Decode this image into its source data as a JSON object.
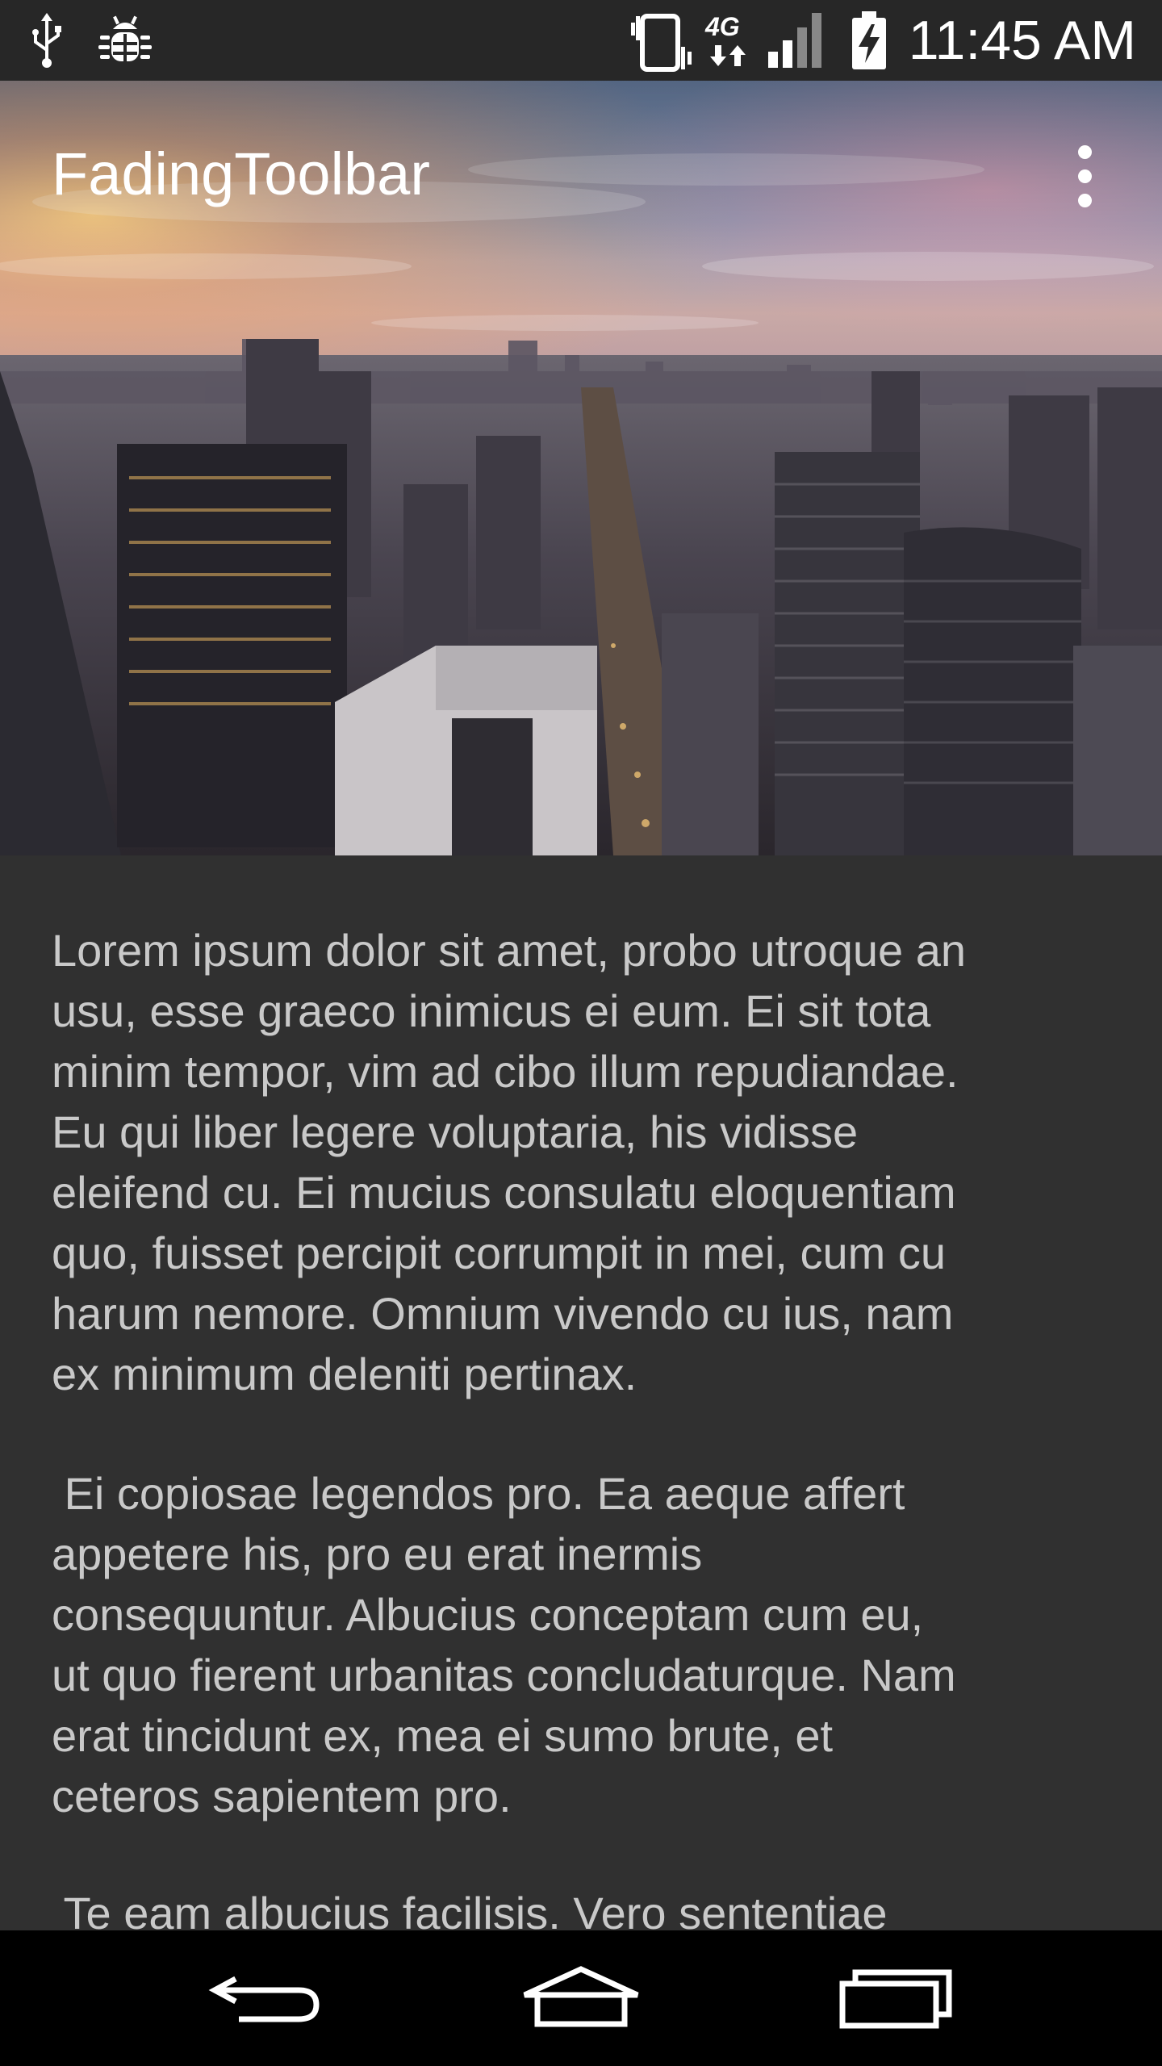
{
  "status_bar": {
    "time": "11:45 AM",
    "network_type": "4G",
    "icons": [
      "usb-icon",
      "debug-icon",
      "vibrate-icon",
      "network-4g-icon",
      "signal-icon",
      "battery-charging-icon"
    ]
  },
  "toolbar": {
    "title": "FadingToolbar",
    "overflow_icon": "more-vert-icon"
  },
  "content": {
    "paragraphs": [
      "Lorem ipsum dolor sit amet, probo utroque an\nusu, esse graeco inimicus ei eum. Ei sit tota\nminim tempor, vim ad cibo illum repudiandae.\nEu qui liber legere voluptaria, his vidisse\neleifend cu. Ei mucius consulatu eloquentiam\nquo, fuisset percipit corrumpit in mei, cum cu\nharum nemore. Omnium vivendo cu ius, nam\nex minimum deleniti pertinax.",
      " Ei copiosae legendos pro. Ea aeque affert\nappetere his, pro eu erat inermis\nconsequuntur. Albucius conceptam cum eu,\nut quo fierent urbanitas concludaturque. Nam\nerat tincidunt ex, mea ei sumo brute, et\nceteros sapientem pro.",
      " Te eam albucius facilisis. Vero sententiae"
    ]
  },
  "nav_bar": {
    "icons": [
      "back-icon",
      "home-icon",
      "recents-icon"
    ]
  },
  "colors": {
    "status_bar_bg": "#272727",
    "content_bg": "#303030",
    "body_text": "#c9c9c9",
    "nav_bar_bg": "#000000",
    "toolbar_text": "#ffffff"
  }
}
